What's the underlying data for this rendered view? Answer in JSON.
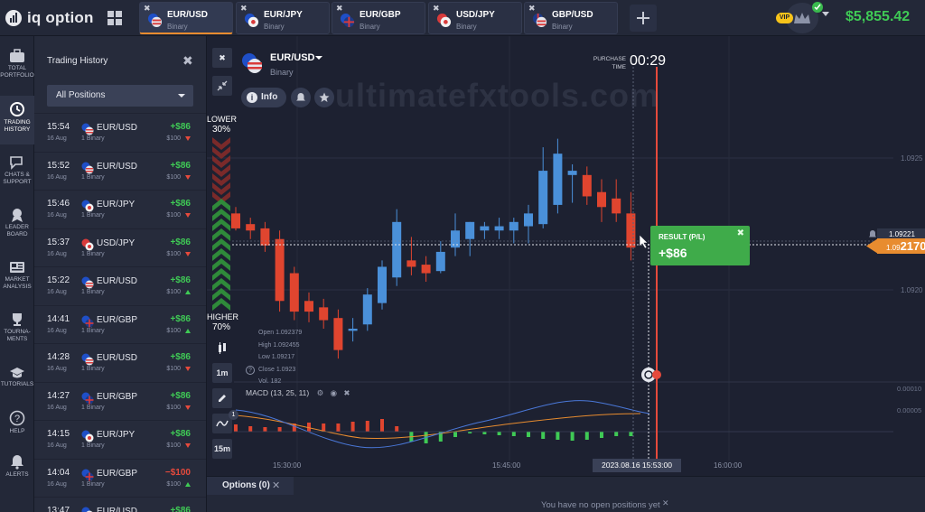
{
  "app": {
    "logo_text": "iq option",
    "balance": "$5,855.42",
    "vip_badge": "VIP"
  },
  "asset_tabs": [
    {
      "name": "EUR/USD",
      "type": "Binary",
      "active": true,
      "flag": "eu-us"
    },
    {
      "name": "EUR/JPY",
      "type": "Binary",
      "active": false,
      "flag": "eu-jp"
    },
    {
      "name": "EUR/GBP",
      "type": "Binary",
      "active": false,
      "flag": "eu-gb"
    },
    {
      "name": "USD/JPY",
      "type": "Binary",
      "active": false,
      "flag": "us-jp"
    },
    {
      "name": "GBP/USD",
      "type": "Binary",
      "active": false,
      "flag": "gb-us"
    }
  ],
  "sidenav": [
    {
      "label": "TOTAL\nPORTFOLIO",
      "icon": "briefcase-icon"
    },
    {
      "label": "TRADING\nHISTORY",
      "icon": "history-icon",
      "active": true
    },
    {
      "label": "CHATS &\nSUPPORT",
      "icon": "chat-icon"
    },
    {
      "label": "LEADER\nBOARD",
      "icon": "medal-icon"
    },
    {
      "label": "MARKET\nANALYSIS",
      "icon": "newspaper-icon"
    },
    {
      "label": "TOURNA-\nMENTS",
      "icon": "trophy-icon"
    },
    {
      "label": "TUTORIALS",
      "icon": "graduation-cap-icon"
    },
    {
      "label": "HELP",
      "icon": "help-icon"
    },
    {
      "label": "ALERTS",
      "icon": "bell-icon"
    }
  ],
  "history": {
    "title": "Trading History",
    "filter": "All Positions",
    "rows": [
      {
        "time": "15:54",
        "date": "16 Aug",
        "asset": "EUR/USD",
        "type": "1 Binary",
        "profit": "+$86",
        "amount": "$100",
        "direction": "down",
        "flag": "eu-us"
      },
      {
        "time": "15:52",
        "date": "16 Aug",
        "asset": "EUR/USD",
        "type": "1 Binary",
        "profit": "+$86",
        "amount": "$100",
        "direction": "down",
        "flag": "eu-us"
      },
      {
        "time": "15:46",
        "date": "16 Aug",
        "asset": "EUR/JPY",
        "type": "1 Binary",
        "profit": "+$86",
        "amount": "$100",
        "direction": "down",
        "flag": "eu-jp"
      },
      {
        "time": "15:37",
        "date": "16 Aug",
        "asset": "USD/JPY",
        "type": "1 Binary",
        "profit": "+$86",
        "amount": "$100",
        "direction": "down",
        "flag": "us-jp"
      },
      {
        "time": "15:22",
        "date": "16 Aug",
        "asset": "EUR/USD",
        "type": "1 Binary",
        "profit": "+$86",
        "amount": "$100",
        "direction": "up",
        "flag": "eu-us"
      },
      {
        "time": "14:41",
        "date": "16 Aug",
        "asset": "EUR/GBP",
        "type": "1 Binary",
        "profit": "+$86",
        "amount": "$100",
        "direction": "up",
        "flag": "eu-gb"
      },
      {
        "time": "14:28",
        "date": "16 Aug",
        "asset": "EUR/USD",
        "type": "1 Binary",
        "profit": "+$86",
        "amount": "$100",
        "direction": "down",
        "flag": "eu-us"
      },
      {
        "time": "14:27",
        "date": "16 Aug",
        "asset": "EUR/GBP",
        "type": "1 Binary",
        "profit": "+$86",
        "amount": "$100",
        "direction": "down",
        "flag": "eu-gb"
      },
      {
        "time": "14:15",
        "date": "16 Aug",
        "asset": "EUR/JPY",
        "type": "1 Binary",
        "profit": "+$86",
        "amount": "$100",
        "direction": "down",
        "flag": "eu-jp"
      },
      {
        "time": "14:04",
        "date": "16 Aug",
        "asset": "EUR/GBP",
        "type": "1 Binary",
        "profit": "−$100",
        "amount": "$100",
        "direction": "up",
        "flag": "eu-gb",
        "loss": true
      },
      {
        "time": "13:47",
        "date": "16 Aug",
        "asset": "EUR/USD",
        "type": "1 Binary",
        "profit": "+$86",
        "amount": "$100",
        "direction": "down",
        "flag": "eu-us"
      }
    ]
  },
  "chart": {
    "asset": "EUR/USD",
    "asset_type": "Binary",
    "info_label": "Info",
    "watermark": "ultimatefxtools.com",
    "purchase_label": "PURCHASE\nTIME",
    "purchase_time": "00:29",
    "lower_label": "LOWER",
    "lower_pct": "30%",
    "higher_label": "HIGHER",
    "higher_pct": "70%",
    "timeframes": [
      "1m",
      "15m"
    ],
    "ohlc": {
      "open": "Open  1.092379",
      "high": "High  1.092455",
      "low": "Low   1.09217",
      "close": "Close  1.0923",
      "vol": "Vol.   182"
    },
    "result_title": "RESULT (P/L)",
    "result_value": "+$86",
    "price_tag_top": "1.09221",
    "price_tag_small": "1.09",
    "price_tag_big": "2170",
    "macd_label": "MACD (13, 25, 11)",
    "price_labels": [
      "1.0925",
      "1.0920"
    ],
    "macd_labels": [
      "0.00010",
      "0.00005"
    ],
    "time_labels": [
      "15:30:00",
      "15:45:00",
      "16:00:00"
    ],
    "cursor_time": "2023.08.16 15:53:00",
    "indicator_badge": "1"
  },
  "bottom": {
    "options_tab": "Options (0)",
    "no_positions": "You have no open positions yet"
  },
  "chart_data": {
    "type": "candlestick",
    "price_range": [
      1.09175,
      1.09285
    ],
    "candles": [
      {
        "o": 1.0924,
        "h": 1.09243,
        "l": 1.09232,
        "c": 1.09233
      },
      {
        "o": 1.09235,
        "h": 1.09238,
        "l": 1.09228,
        "c": 1.09232
      },
      {
        "o": 1.09233,
        "h": 1.09236,
        "l": 1.09222,
        "c": 1.09225
      },
      {
        "o": 1.09228,
        "h": 1.09232,
        "l": 1.09194,
        "c": 1.09199
      },
      {
        "o": 1.09212,
        "h": 1.09215,
        "l": 1.0919,
        "c": 1.09194
      },
      {
        "o": 1.09199,
        "h": 1.09203,
        "l": 1.09189,
        "c": 1.09194
      },
      {
        "o": 1.09196,
        "h": 1.092,
        "l": 1.09186,
        "c": 1.0919
      },
      {
        "o": 1.09191,
        "h": 1.09195,
        "l": 1.09172,
        "c": 1.09176
      },
      {
        "o": 1.09185,
        "h": 1.09191,
        "l": 1.0918,
        "c": 1.09186
      },
      {
        "o": 1.09188,
        "h": 1.09205,
        "l": 1.09185,
        "c": 1.09202
      },
      {
        "o": 1.09198,
        "h": 1.09218,
        "l": 1.09195,
        "c": 1.09215
      },
      {
        "o": 1.0921,
        "h": 1.09242,
        "l": 1.09206,
        "c": 1.09236
      },
      {
        "o": 1.09218,
        "h": 1.09229,
        "l": 1.09211,
        "c": 1.09215
      },
      {
        "o": 1.09216,
        "h": 1.0922,
        "l": 1.09208,
        "c": 1.09212
      },
      {
        "o": 1.09213,
        "h": 1.09227,
        "l": 1.09212,
        "c": 1.09222
      },
      {
        "o": 1.09224,
        "h": 1.0924,
        "l": 1.0922,
        "c": 1.09232
      },
      {
        "o": 1.09228,
        "h": 1.09236,
        "l": 1.0922,
        "c": 1.09236
      },
      {
        "o": 1.09232,
        "h": 1.09236,
        "l": 1.09228,
        "c": 1.09234
      },
      {
        "o": 1.09232,
        "h": 1.09238,
        "l": 1.09228,
        "c": 1.09234
      },
      {
        "o": 1.09232,
        "h": 1.09238,
        "l": 1.09226,
        "c": 1.09236
      },
      {
        "o": 1.09234,
        "h": 1.09244,
        "l": 1.09226,
        "c": 1.0924
      },
      {
        "o": 1.09235,
        "h": 1.09271,
        "l": 1.09233,
        "c": 1.0926
      },
      {
        "o": 1.09244,
        "h": 1.09275,
        "l": 1.0924,
        "c": 1.09268
      },
      {
        "o": 1.09258,
        "h": 1.09263,
        "l": 1.09245,
        "c": 1.0926
      },
      {
        "o": 1.09258,
        "h": 1.09262,
        "l": 1.09244,
        "c": 1.09248
      },
      {
        "o": 1.0925,
        "h": 1.09256,
        "l": 1.09236,
        "c": 1.09243
      },
      {
        "o": 1.09247,
        "h": 1.09256,
        "l": 1.09236,
        "c": 1.0924
      },
      {
        "o": 1.0924,
        "h": 1.0925,
        "l": 1.09218,
        "c": 1.09224
      }
    ],
    "macd_histogram": [
      0.8,
      0.6,
      0.5,
      0.5,
      0.9,
      1.0,
      0.9,
      0.9,
      1.1,
      1.2,
      1.4,
      0.6,
      -1.1,
      -1.3,
      -1.1,
      -0.6,
      -0.2,
      -0.3,
      -0.4,
      -0.5,
      -0.6,
      -0.8,
      -0.9,
      -1.0,
      -0.9,
      -0.7,
      -0.5,
      -0.5
    ]
  }
}
